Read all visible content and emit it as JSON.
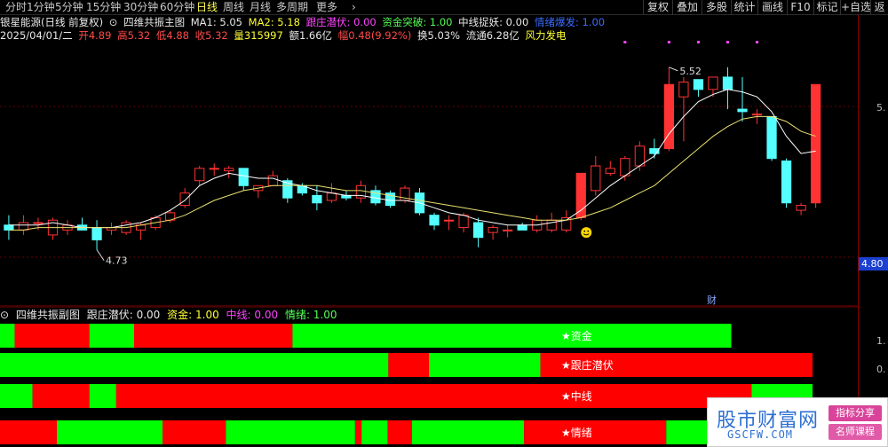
{
  "toolbar": {
    "periods": [
      {
        "label": "分时"
      },
      {
        "label": "1分钟"
      },
      {
        "label": "5分钟"
      },
      {
        "label": "15分钟"
      },
      {
        "label": "30分钟"
      },
      {
        "label": "60分钟"
      },
      {
        "label": "日线",
        "active": true
      },
      {
        "label": "周线"
      },
      {
        "label": "月线"
      },
      {
        "label": "多周期"
      },
      {
        "label": "更多"
      }
    ],
    "right_buttons": [
      "复权",
      "叠加",
      "多股",
      "统计",
      "画线",
      "F10",
      "标记",
      "+自选",
      "返"
    ]
  },
  "header": {
    "stock": "银星能源(日线 前复权)",
    "indicator_name": "四维共振主图",
    "ma1": "MA1: 5.05",
    "ma2": "MA2: 5.18",
    "zhuang": "跟庄潜伏: 0.00",
    "zijin": "资金突破: 1.00",
    "zhongxian": "中线捉妖: 0.00",
    "qingxu": "情绪爆发: 1.00"
  },
  "quote": {
    "date": "2025/04/01/二",
    "open": "开4.89",
    "high": "高5.32",
    "low": "低4.88",
    "close": "收5.32",
    "volume": "量315997",
    "amount": "额1.66亿",
    "change": "幅0.48(9.92%)",
    "turnover": "换5.03%",
    "float": "流通6.28亿",
    "sector": "风力发电"
  },
  "price_axis": {
    "labels": [
      "5.",
      "4.80",
      "1.",
      "0."
    ],
    "current_price": "4.80"
  },
  "chart_data": {
    "type": "candlestick",
    "annotations": {
      "high_label": "5.52",
      "low_label": "4.73",
      "finance_marker": "财"
    },
    "ylim": [
      4.55,
      5.6
    ],
    "candles": [
      {
        "o": 4.86,
        "h": 4.9,
        "l": 4.8,
        "c": 4.84
      },
      {
        "o": 4.84,
        "h": 4.9,
        "l": 4.82,
        "c": 4.87
      },
      {
        "o": 4.87,
        "h": 4.89,
        "l": 4.84,
        "c": 4.87
      },
      {
        "o": 4.82,
        "h": 4.89,
        "l": 4.8,
        "c": 4.88
      },
      {
        "o": 4.84,
        "h": 4.88,
        "l": 4.82,
        "c": 4.86
      },
      {
        "o": 4.86,
        "h": 4.89,
        "l": 4.84,
        "c": 4.84
      },
      {
        "o": 4.85,
        "h": 4.88,
        "l": 4.76,
        "c": 4.8
      },
      {
        "o": 4.84,
        "h": 4.87,
        "l": 4.82,
        "c": 4.85
      },
      {
        "o": 4.83,
        "h": 4.88,
        "l": 4.82,
        "c": 4.87
      },
      {
        "o": 4.84,
        "h": 4.87,
        "l": 4.8,
        "c": 4.86
      },
      {
        "o": 4.85,
        "h": 4.9,
        "l": 4.84,
        "c": 4.89
      },
      {
        "o": 4.88,
        "h": 4.92,
        "l": 4.87,
        "c": 4.91
      },
      {
        "o": 4.94,
        "h": 5.01,
        "l": 4.93,
        "c": 4.99
      },
      {
        "o": 5.04,
        "h": 5.1,
        "l": 5.02,
        "c": 5.09
      },
      {
        "o": 5.09,
        "h": 5.11,
        "l": 5.06,
        "c": 5.09
      },
      {
        "o": 5.08,
        "h": 5.1,
        "l": 5.05,
        "c": 5.09
      },
      {
        "o": 5.09,
        "h": 5.08,
        "l": 5.0,
        "c": 5.02
      },
      {
        "o": 5.0,
        "h": 5.02,
        "l": 4.97,
        "c": 5.02
      },
      {
        "o": 5.02,
        "h": 5.08,
        "l": 5.02,
        "c": 5.06
      },
      {
        "o": 5.04,
        "h": 5.05,
        "l": 4.95,
        "c": 4.97
      },
      {
        "o": 5.02,
        "h": 5.03,
        "l": 4.98,
        "c": 4.99
      },
      {
        "o": 4.98,
        "h": 5.02,
        "l": 4.92,
        "c": 4.95
      },
      {
        "o": 4.96,
        "h": 5.03,
        "l": 4.95,
        "c": 4.99
      },
      {
        "o": 4.98,
        "h": 5.0,
        "l": 4.96,
        "c": 4.97
      },
      {
        "o": 4.97,
        "h": 5.04,
        "l": 4.95,
        "c": 5.02
      },
      {
        "o": 5.0,
        "h": 5.02,
        "l": 4.94,
        "c": 4.95
      },
      {
        "o": 4.99,
        "h": 5.0,
        "l": 4.93,
        "c": 4.94
      },
      {
        "o": 4.96,
        "h": 5.02,
        "l": 4.95,
        "c": 5.01
      },
      {
        "o": 4.99,
        "h": 5.01,
        "l": 4.9,
        "c": 4.91
      },
      {
        "o": 4.9,
        "h": 4.91,
        "l": 4.84,
        "c": 4.86
      },
      {
        "o": 4.88,
        "h": 4.9,
        "l": 4.84,
        "c": 4.88
      },
      {
        "o": 4.85,
        "h": 4.91,
        "l": 4.83,
        "c": 4.9
      },
      {
        "o": 4.87,
        "h": 4.89,
        "l": 4.77,
        "c": 4.81
      },
      {
        "o": 4.83,
        "h": 4.86,
        "l": 4.8,
        "c": 4.85
      },
      {
        "o": 4.84,
        "h": 4.86,
        "l": 4.81,
        "c": 4.84
      },
      {
        "o": 4.86,
        "h": 4.87,
        "l": 4.84,
        "c": 4.84
      },
      {
        "o": 4.84,
        "h": 4.9,
        "l": 4.83,
        "c": 4.88
      },
      {
        "o": 4.84,
        "h": 4.91,
        "l": 4.83,
        "c": 4.88
      },
      {
        "o": 4.84,
        "h": 4.92,
        "l": 4.83,
        "c": 4.89
      },
      {
        "o": 4.89,
        "h": 5.07,
        "l": 4.88,
        "c": 5.07
      },
      {
        "o": 5.0,
        "h": 5.14,
        "l": 4.98,
        "c": 5.1
      },
      {
        "o": 5.07,
        "h": 5.12,
        "l": 5.06,
        "c": 5.09
      },
      {
        "o": 5.06,
        "h": 5.14,
        "l": 5.04,
        "c": 5.13
      },
      {
        "o": 5.1,
        "h": 5.2,
        "l": 5.08,
        "c": 5.18
      },
      {
        "o": 5.17,
        "h": 5.21,
        "l": 5.13,
        "c": 5.15
      },
      {
        "o": 5.17,
        "h": 5.5,
        "l": 5.16,
        "c": 5.43
      },
      {
        "o": 5.38,
        "h": 5.46,
        "l": 5.2,
        "c": 5.44
      },
      {
        "o": 5.45,
        "h": 5.45,
        "l": 5.38,
        "c": 5.41
      },
      {
        "o": 5.41,
        "h": 5.46,
        "l": 5.38,
        "c": 5.46
      },
      {
        "o": 5.46,
        "h": 5.5,
        "l": 5.33,
        "c": 5.41
      },
      {
        "o": 5.33,
        "h": 5.46,
        "l": 5.28,
        "c": 5.32
      },
      {
        "o": 5.31,
        "h": 5.33,
        "l": 5.27,
        "c": 5.31
      },
      {
        "o": 5.3,
        "h": 5.29,
        "l": 5.12,
        "c": 5.13
      },
      {
        "o": 5.12,
        "h": 5.13,
        "l": 4.93,
        "c": 4.95
      },
      {
        "o": 4.92,
        "h": 4.95,
        "l": 4.9,
        "c": 4.94
      },
      {
        "o": 4.95,
        "h": 5.43,
        "l": 4.93,
        "c": 5.43
      }
    ],
    "ma1": [
      4.86,
      4.86,
      4.86,
      4.87,
      4.86,
      4.85,
      4.85,
      4.85,
      4.86,
      4.87,
      4.89,
      4.92,
      4.96,
      5.02,
      5.05,
      5.07,
      5.06,
      5.05,
      5.05,
      5.03,
      5.02,
      5.0,
      4.99,
      4.98,
      4.98,
      4.97,
      4.96,
      4.96,
      4.95,
      4.93,
      4.91,
      4.9,
      4.88,
      4.87,
      4.86,
      4.86,
      4.86,
      4.87,
      4.88,
      4.92,
      4.97,
      5.02,
      5.06,
      5.1,
      5.14,
      5.23,
      5.3,
      5.36,
      5.39,
      5.41,
      5.4,
      5.38,
      5.32,
      5.22,
      5.15,
      5.16
    ],
    "ma2": [
      4.84,
      4.84,
      4.85,
      4.85,
      4.85,
      4.85,
      4.85,
      4.85,
      4.85,
      4.86,
      4.87,
      4.88,
      4.9,
      4.93,
      4.96,
      4.98,
      5.0,
      5.01,
      5.02,
      5.02,
      5.02,
      5.02,
      5.01,
      5.0,
      5.0,
      4.99,
      4.98,
      4.97,
      4.96,
      4.95,
      4.94,
      4.93,
      4.92,
      4.91,
      4.9,
      4.89,
      4.88,
      4.88,
      4.88,
      4.89,
      4.91,
      4.93,
      4.96,
      4.99,
      5.02,
      5.07,
      5.12,
      5.17,
      5.22,
      5.26,
      5.29,
      5.3,
      5.3,
      5.28,
      5.24,
      5.22
    ],
    "signal_dots_x_index": [
      42,
      45,
      47,
      49,
      51
    ]
  },
  "sub_panel": {
    "title": "四维共振副图",
    "zhuang": "跟庄潜伏: 0.00",
    "zijin": "资金: 1.00",
    "zhongxian": "中线: 0.00",
    "qingxu": "情绪: 1.00",
    "colors": {
      "red": "#ff0000",
      "green": "#00ff00"
    },
    "strips": [
      {
        "label": "★资金",
        "segments": [
          [
            "g",
            0.018
          ],
          [
            "r",
            0.11
          ],
          [
            "g",
            0.165
          ],
          [
            "r",
            0.36
          ],
          [
            "g",
            0.9
          ]
        ]
      },
      {
        "label": "★跟庄潜伏",
        "segments": [
          [
            "g",
            0.478
          ],
          [
            "r",
            0.528
          ],
          [
            "g",
            0.665
          ],
          [
            "r",
            1.0
          ]
        ]
      },
      {
        "label": "★中线",
        "segments": [
          [
            "g",
            0.04
          ],
          [
            "r",
            0.11
          ],
          [
            "g",
            0.143
          ],
          [
            "r",
            0.925
          ],
          [
            "g",
            1.0
          ]
        ]
      },
      {
        "label": "★情绪",
        "segments": [
          [
            "r",
            0.07
          ],
          [
            "g",
            0.2
          ],
          [
            "r",
            0.278
          ],
          [
            "g",
            0.437
          ],
          [
            "r",
            0.445
          ],
          [
            "g",
            0.477
          ],
          [
            "r",
            0.507
          ],
          [
            "g",
            0.645
          ],
          [
            "r",
            0.82
          ],
          [
            "g",
            1.0
          ]
        ]
      }
    ]
  },
  "watermark": {
    "title": "股市财富网",
    "url": "GSCFW.COM",
    "tag1": "指标分享",
    "tag2": "名师课程"
  }
}
